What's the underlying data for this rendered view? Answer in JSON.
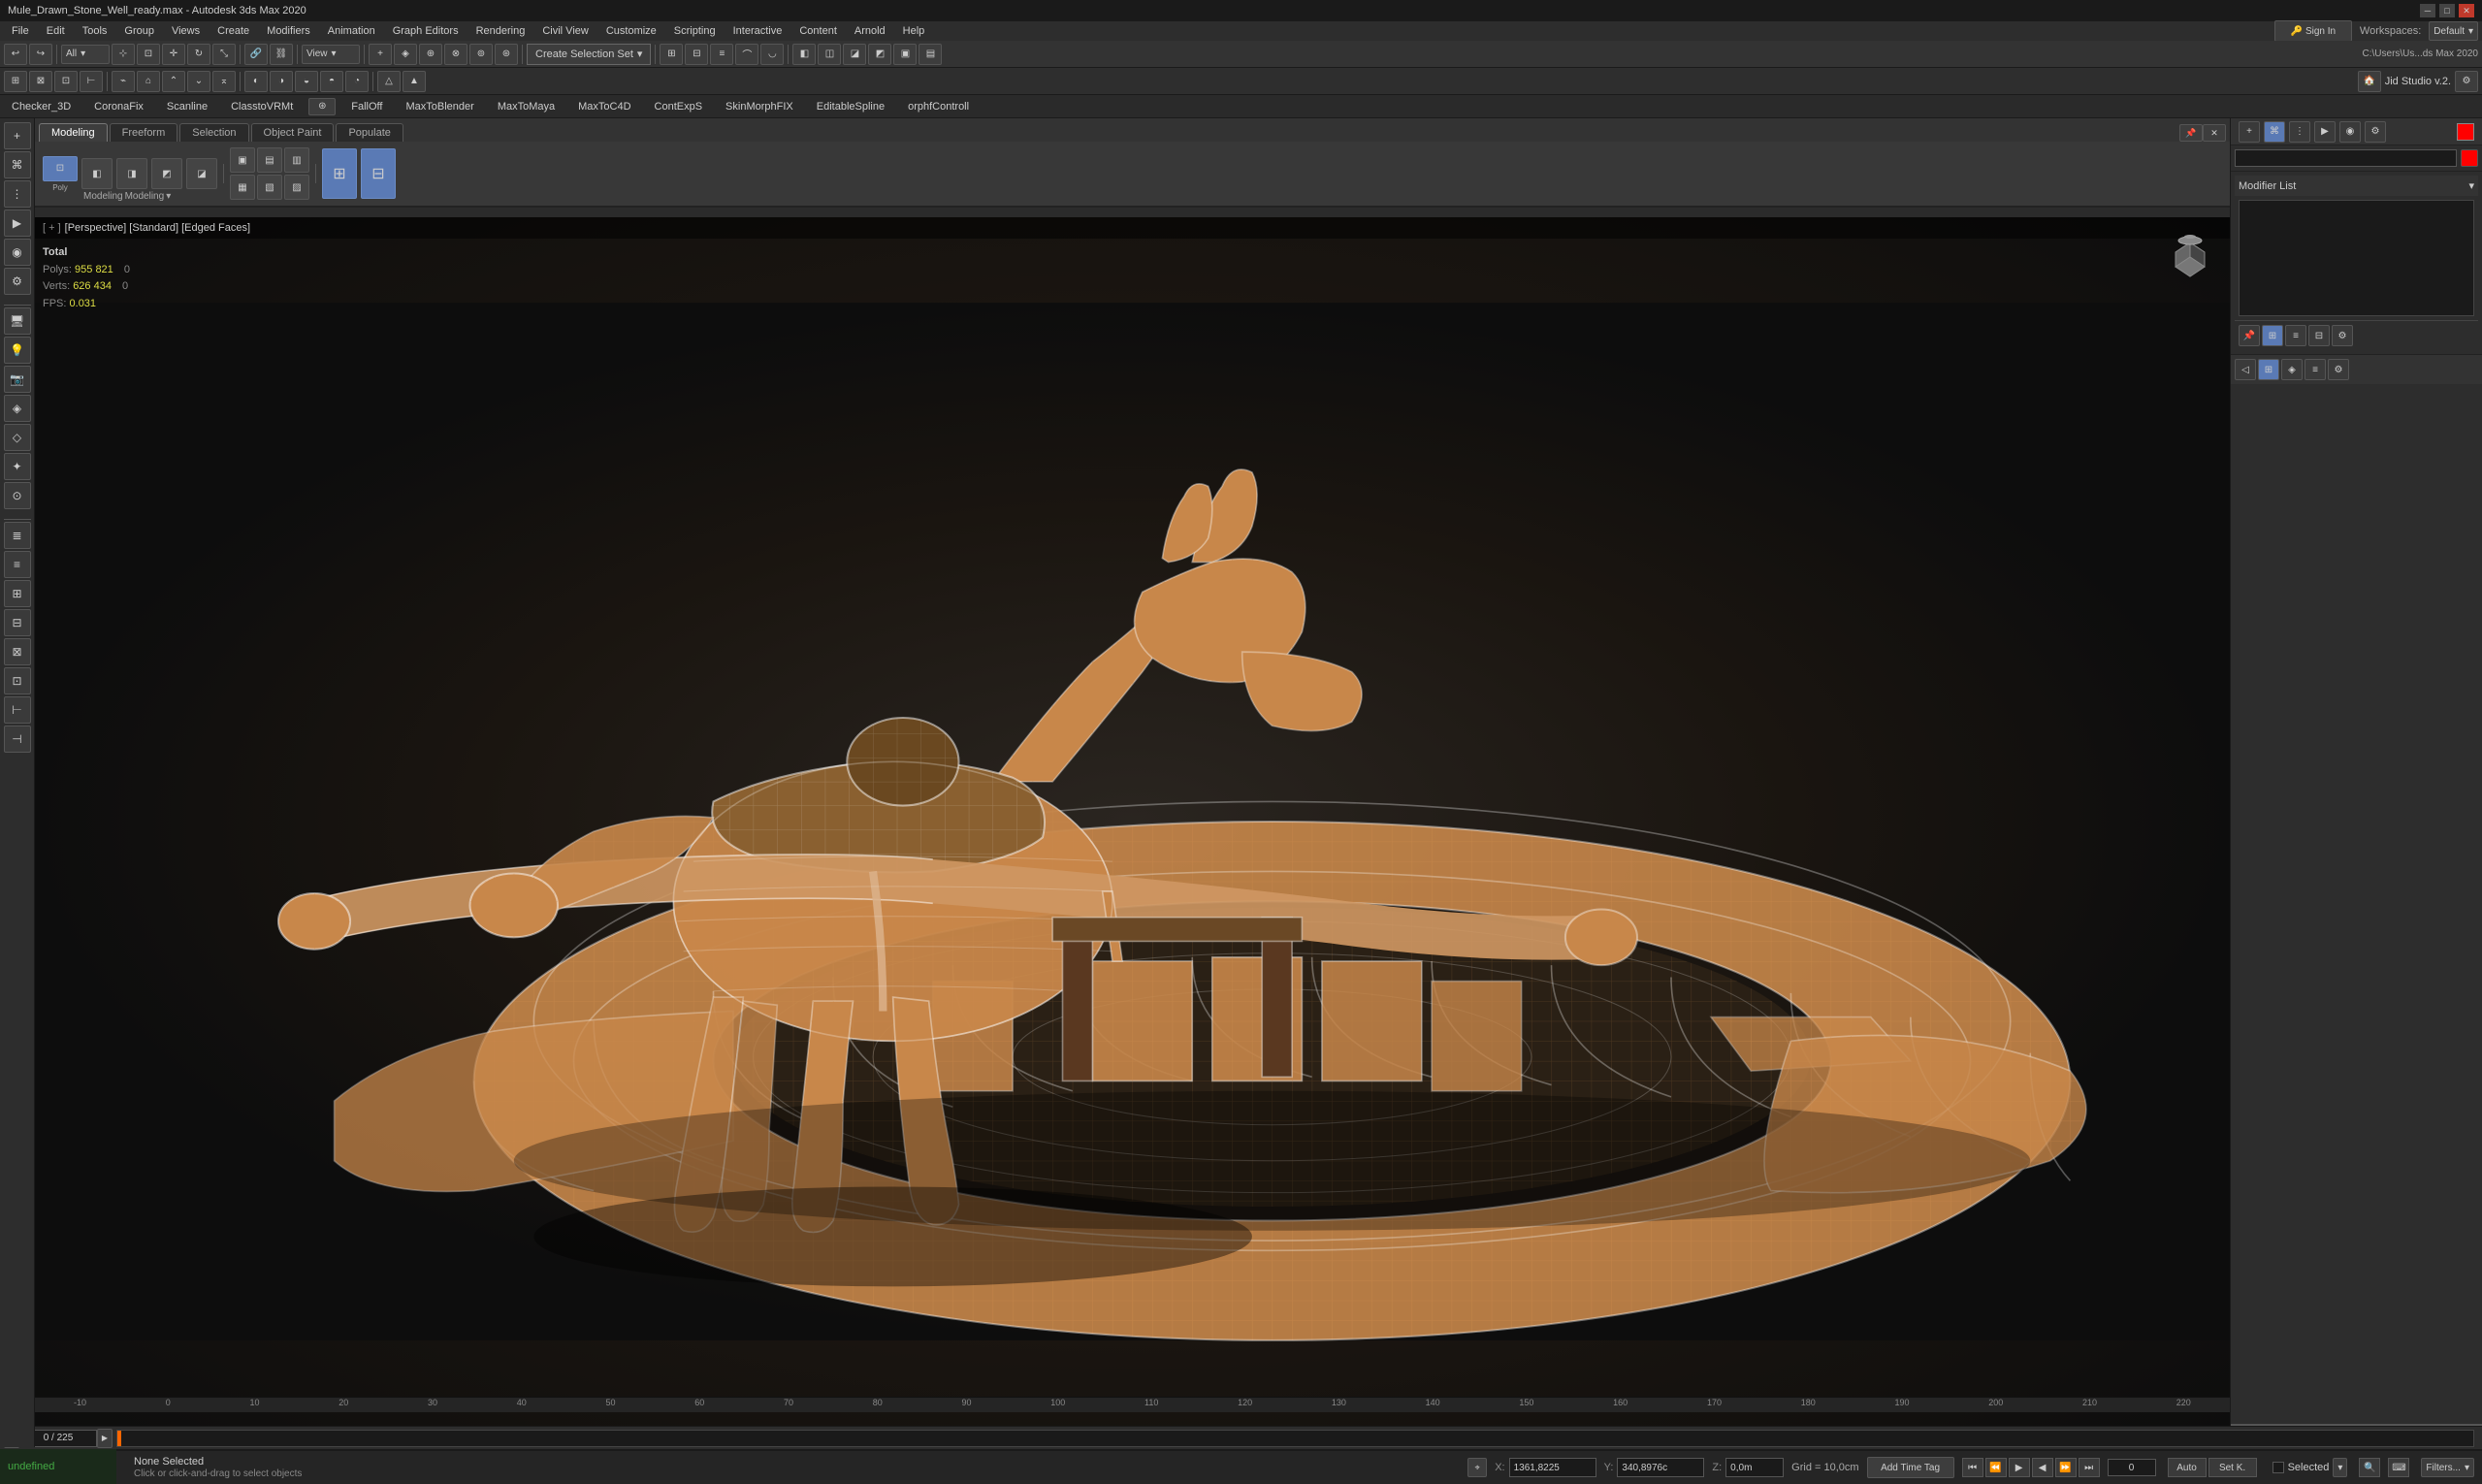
{
  "window": {
    "title": "Mule_Drawn_Stone_Well_ready.max - Autodesk 3ds Max 2020",
    "controls": [
      "minimize",
      "maximize",
      "close"
    ]
  },
  "menu": {
    "items": [
      "File",
      "Edit",
      "Tools",
      "Group",
      "Views",
      "Create",
      "Modifiers",
      "Animation",
      "Graph Editors",
      "Rendering",
      "Civil View",
      "Customize",
      "Scripting",
      "Interactive",
      "Content",
      "Arnold",
      "Help"
    ]
  },
  "toolbar": {
    "filter_dropdown": "All",
    "view_dropdown": "View",
    "create_selection_set": "Create Selection Set",
    "workspace_label": "Workspaces:",
    "workspace_value": "Default",
    "path": "C:\\Users\\Us...ds Max 2020"
  },
  "plugins": {
    "items": [
      "Checker_3D",
      "CoronaFix",
      "Scanline",
      "ClasstoVRMt",
      "FallOff",
      "MaxToBlender",
      "MaxToMaya",
      "MaxToC4D",
      "ContExpS",
      "SkinMorphFIX",
      "EditableSpline",
      "orphfControll"
    ]
  },
  "tabs": {
    "items": [
      "Modeling",
      "Freeform",
      "Selection",
      "Object Paint",
      "Populate"
    ],
    "active": "Modeling"
  },
  "viewport": {
    "header": "[ + ] [Perspective] [Standard] [Edged Faces]",
    "stats": {
      "total_label": "Total",
      "polys_label": "Polys:",
      "polys_value": "955 821",
      "polys_extra": "0",
      "verts_label": "Verts:",
      "verts_value": "626 434",
      "verts_extra": "0",
      "fps_label": "FPS:",
      "fps_value": "0.031"
    }
  },
  "right_panel": {
    "modifier_list_label": "Modifier List",
    "tab_icons": [
      "hierarchy",
      "motion",
      "display",
      "utilities"
    ],
    "panel_icon_active": 1
  },
  "status_bar": {
    "selection": "None Selected",
    "hint": "Click or click-and-drag to select objects",
    "x_label": "X:",
    "x_value": "1361,8225",
    "y_label": "Y:",
    "y_value": "340,8976c",
    "z_label": "Z:",
    "z_value": "0,0m",
    "grid_label": "Grid = 10,0cm",
    "add_time_tag": "Add Time Tag",
    "selected_badge": "Selected",
    "auto_label": "Auto",
    "set_k": "Set K.",
    "filters": "Filters..."
  },
  "timeline": {
    "frame_current": "0",
    "frame_total": "225",
    "frame_display": "0 / 225",
    "ruler_marks": [
      "-10",
      "0",
      "10",
      "20",
      "30",
      "40",
      "50",
      "60",
      "70",
      "80",
      "90",
      "100",
      "110",
      "120",
      "130",
      "140",
      "150",
      "160",
      "170",
      "180",
      "190",
      "200",
      "210",
      "220"
    ]
  },
  "studio": {
    "label": "Jid Studio v.2."
  },
  "colors": {
    "accent_blue": "#4a6fa5",
    "active_tab_bg": "#3d3d3d",
    "viewport_bg": "#1a1510",
    "mesh_color": "#c8874a",
    "wire_color": "#ffffff",
    "stat_yellow": "#dddd44",
    "status_green": "#44aa44",
    "red_swatch": "#ff0000"
  }
}
